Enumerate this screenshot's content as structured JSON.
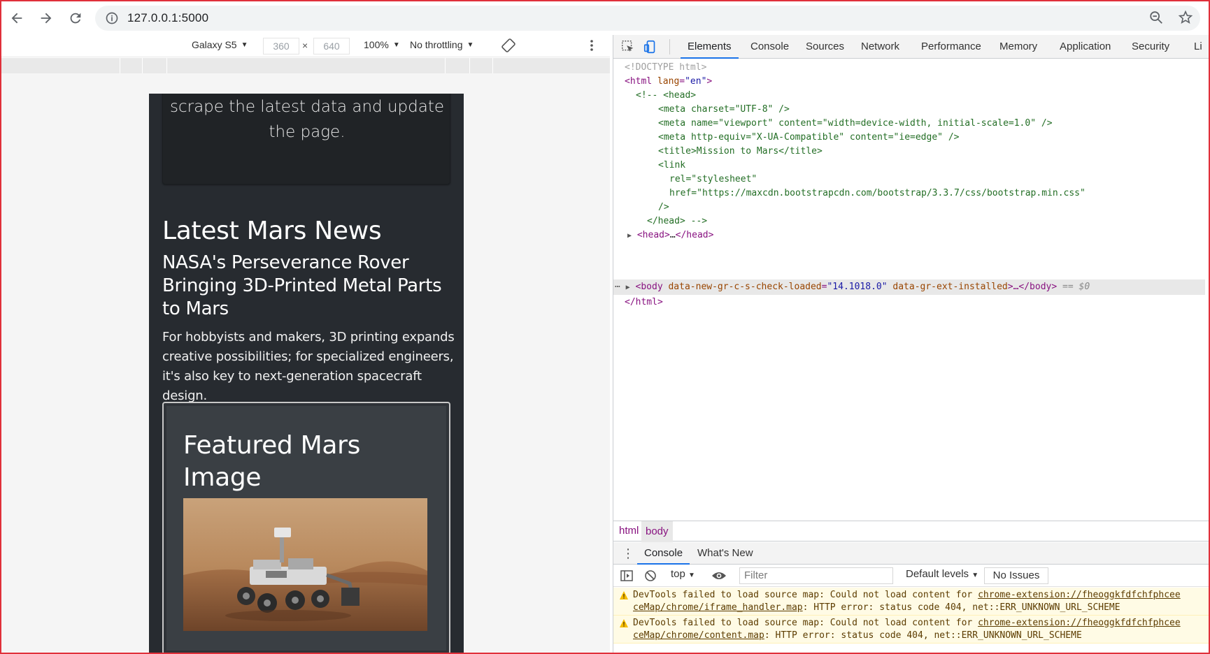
{
  "browser": {
    "url": "127.0.0.1:5000"
  },
  "device_toolbar": {
    "device": "Galaxy S5",
    "width": "360",
    "x_sep": "×",
    "height": "640",
    "zoom": "100%",
    "throttling": "No throttling"
  },
  "page": {
    "top_card_text": "scrape the latest data and update the page.",
    "news_heading": "Latest Mars News",
    "news_title": "NASA's Perseverance Rover Bringing 3D-Printed Metal Parts to Mars",
    "news_paragraph": "For hobbyists and makers, 3D printing expands creative possibilities; for specialized engineers, it's also key to next-generation spacecraft design.",
    "featured_heading": "Featured Mars Image"
  },
  "devtools": {
    "tabs": [
      "Elements",
      "Console",
      "Sources",
      "Network",
      "Performance",
      "Memory",
      "Application",
      "Security",
      "Li"
    ],
    "active_tab": "Elements",
    "dom_lines": {
      "doctype": "<!DOCTYPE html>",
      "html_open_tag": "<html",
      "html_lang_attr": " lang",
      "html_lang_val": "\"en\"",
      "html_close_bracket": ">",
      "comment_head": "<!-- <head>",
      "meta_charset": "<meta charset=\"UTF-8\" />",
      "meta_viewport": "<meta name=\"viewport\" content=\"width=device-width, initial-scale=1.0\" />",
      "meta_compat": "<meta http-equiv=\"X-UA-Compatible\" content=\"ie=edge\" />",
      "title": "<title>Mission to Mars</title>",
      "link_open": "<link",
      "link_rel": "rel=\"stylesheet\"",
      "link_href": "href=\"https://maxcdn.bootstrapcdn.com/bootstrap/3.3.7/css/bootstrap.min.css\"",
      "link_close": "/>",
      "comment_close": "</head> -->",
      "head_collapsed_open": "<head>",
      "head_collapsed_ellipsis": "…",
      "head_collapsed_close": "</head>",
      "body_open": "<body",
      "body_attr1": " data-new-gr-c-s-check-loaded",
      "body_eq": "=",
      "body_val1": "\"14.1018.0\"",
      "body_attr2": " data-gr-ext-installed",
      "body_rest": ">…</body>",
      "body_marker": " == $0",
      "html_close": "</html>"
    },
    "breadcrumbs": [
      "html",
      "body"
    ],
    "drawer": {
      "tabs": [
        "Console",
        "What's New"
      ],
      "active": "Console",
      "context": "top",
      "filter_placeholder": "Filter",
      "levels": "Default levels",
      "issues": "No Issues"
    },
    "messages": [
      {
        "line1_prefix": "DevTools failed to load source map: Could not load content for ",
        "line1_link": "chrome-extension://fheoggkfdfchfphcee",
        "line2_link": "ceMap/chrome/iframe_handler.map",
        "line2_suffix": ": HTTP error: status code 404, net::ERR_UNKNOWN_URL_SCHEME"
      },
      {
        "line1_prefix": "DevTools failed to load source map: Could not load content for ",
        "line1_link": "chrome-extension://fheoggkfdfchfphcee",
        "line2_link": "ceMap/chrome/content.map",
        "line2_suffix": ": HTTP error: status code 404, net::ERR_UNKNOWN_URL_SCHEME"
      }
    ]
  }
}
